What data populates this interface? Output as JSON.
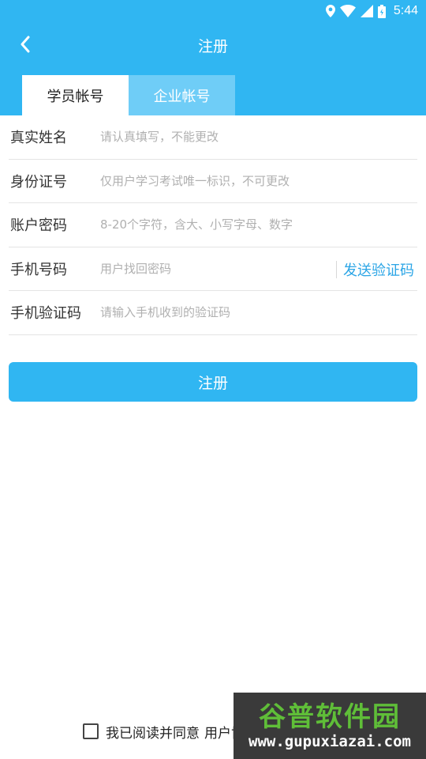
{
  "status_bar": {
    "time": "5:44",
    "icons": [
      "location-icon",
      "wifi-icon",
      "signal-icon",
      "battery-icon"
    ]
  },
  "header": {
    "title": "注册",
    "back_icon": "chevron-left-icon"
  },
  "tabs": [
    {
      "label": "学员帐号",
      "selected": true
    },
    {
      "label": "企业帐号",
      "selected": false
    }
  ],
  "form": {
    "fields": [
      {
        "label": "真实姓名",
        "placeholder": "请认真填写，不能更改"
      },
      {
        "label": "身份证号",
        "placeholder": "仅用户学习考试唯一标识，不可更改"
      },
      {
        "label": "账户密码",
        "placeholder": "8-20个字符，含大、小写字母、数字"
      },
      {
        "label": "手机号码",
        "placeholder": "用户找回密码"
      },
      {
        "label": "手机验证码",
        "placeholder": "请输入手机收到的验证码"
      }
    ],
    "send_code_label": "发送验证码"
  },
  "submit_label": "注册",
  "agreement": {
    "text": "我已阅读并同意",
    "link": "用户协议和隐私政策",
    "checked": false
  },
  "watermark": {
    "main": "谷普软件园",
    "url": "www.gupuxiazai.com"
  },
  "colors": {
    "primary": "#30b6f2",
    "tab_inactive": "#6fcdf7",
    "link": "#2ba5e6",
    "watermark_green": "#5fbe38"
  }
}
